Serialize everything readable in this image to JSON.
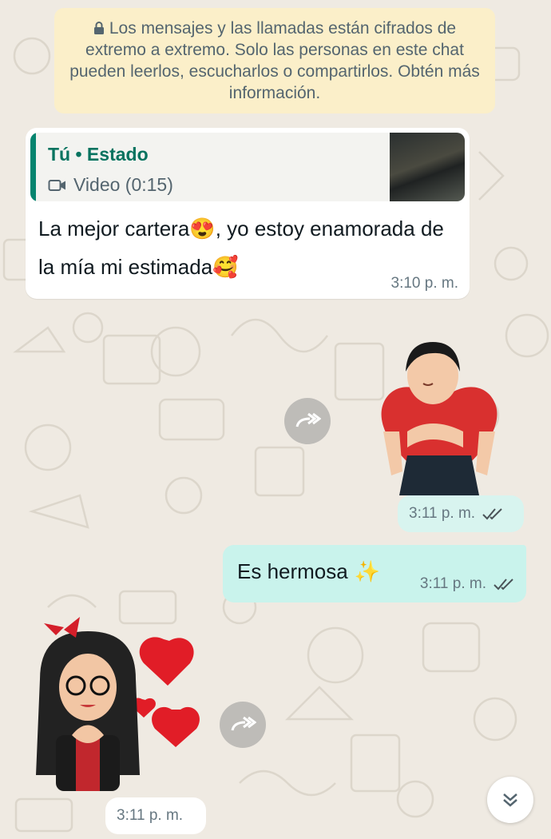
{
  "encryption_notice": {
    "text": "Los mensajes y las llamadas están cifrados de extremo a extremo. Solo las personas en este chat pueden leerlos, escucharlos o compartirlos. Obtén más información."
  },
  "incoming_message": {
    "quote": {
      "author": "Tú • Estado",
      "media_label": "Video (0:15)"
    },
    "text_part1": "La mejor cartera",
    "emoji1": "😍",
    "text_part2": ", yo estoy enamorada de la mía mi estimada",
    "emoji2": "🥰",
    "time": "3:10 p. m."
  },
  "sticker_out": {
    "time": "3:11 p. m."
  },
  "outgoing_message": {
    "text": "Es hermosa",
    "emoji": "✨",
    "time": "3:11 p. m."
  },
  "sticker_in": {
    "time": "3:11 p. m."
  },
  "colors": {
    "accent": "#06846f",
    "outgoing_bubble": "#c9f3ec",
    "read_ticks": "#4a5358"
  }
}
